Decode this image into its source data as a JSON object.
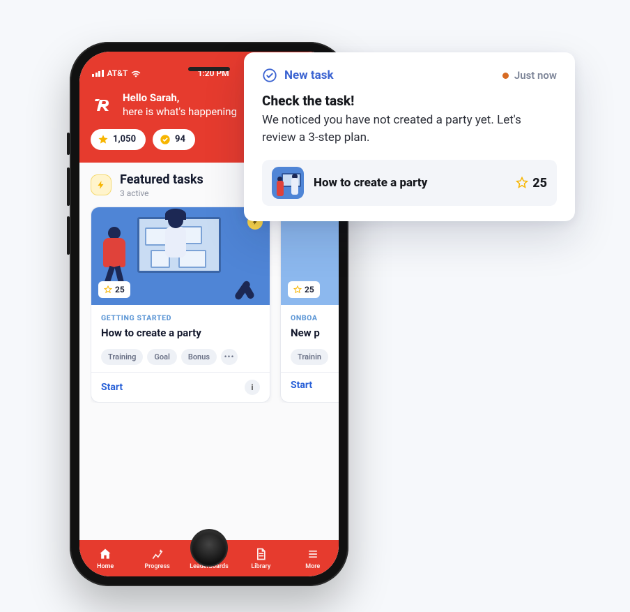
{
  "status": {
    "carrier": "AT&T",
    "time": "1:20 PM"
  },
  "hero": {
    "greeting_prefix": "Hello ",
    "name": "Sarah",
    "greeting_suffix": ",",
    "subline": "here is what's happening",
    "stats": {
      "stars": "1,050",
      "checks": "94"
    }
  },
  "featured": {
    "title": "Featured tasks",
    "subtitle": "3 active"
  },
  "cards": [
    {
      "points": "25",
      "eyebrow": "GETTING STARTED",
      "title": "How to create a party",
      "tags": [
        "Training",
        "Goal",
        "Bonus"
      ],
      "more": "•••",
      "start": "Start"
    },
    {
      "points": "25",
      "eyebrow": "ONBOA",
      "title": "New p",
      "tags": [
        "Trainin"
      ],
      "start": "Start"
    }
  ],
  "tabs": {
    "home": "Home",
    "progress": "Progress",
    "leaderboards": "Leaderboards",
    "library": "Library",
    "more": "More"
  },
  "notification": {
    "badge": "New task",
    "time": "Just now",
    "title": "Check the task!",
    "body": "We noticed you have not created a party yet. Let's review a 3-step plan.",
    "item_title": "How to create a party",
    "item_points": "25"
  },
  "info_glyph": "i",
  "colors": {
    "primary": "#e63b2e",
    "link": "#2860d7",
    "accent_yellow": "#f7b500",
    "accent_orange": "#d76b23"
  }
}
